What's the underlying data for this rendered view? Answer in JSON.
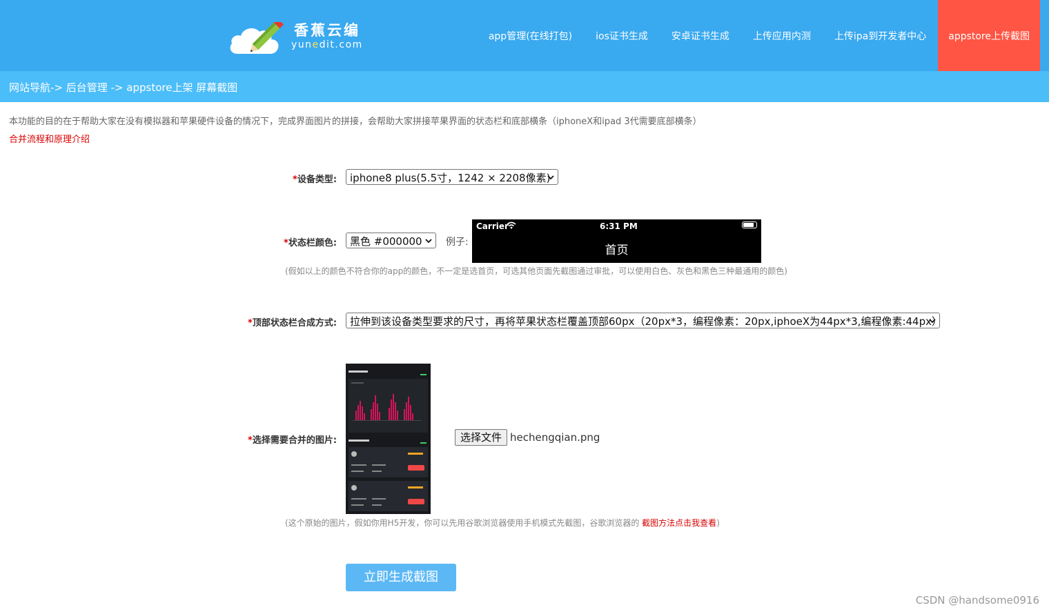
{
  "header": {
    "logo_title": "香蕉云编",
    "logo_domain_pre": "yun",
    "logo_domain_accent": "e",
    "logo_domain_post": "dit.com",
    "nav": [
      {
        "label": "app管理(在线打包)"
      },
      {
        "label": "ios证书生成"
      },
      {
        "label": "安卓证书生成"
      },
      {
        "label": "上传应用内测"
      },
      {
        "label": "上传ipa到开发者中心"
      },
      {
        "label": "appstore上传截图",
        "active": true
      }
    ],
    "bg_color": "#39a9f0",
    "active_color": "#ff5544"
  },
  "breadcrumb": "网站导航-> 后台管理 -> appstore上架 屏幕截图",
  "intro": {
    "text": "本功能的目的在于帮助大家在没有模拟器和苹果硬件设备的情况下，完成界面图片的拼接，会帮助大家拼接苹果界面的状态栏和底部横条（iphoneX和ipad 3代需要底部横条）",
    "link": "合并流程和原理介绍"
  },
  "form": {
    "required_mark": "*",
    "device": {
      "label": "设备类型:",
      "value": "iphone8 plus(5.5寸，1242 × 2208像素)"
    },
    "status_color": {
      "label": "状态栏颜色:",
      "value": "黑色 #000000",
      "example_label": "例子:",
      "hint": "(假如以上的颜色不符合你的app的颜色，不一定是选首页，可选其他页面先截图通过审批，可以使用白色、灰色和黑色三种最通用的颜色)",
      "preview": {
        "carrier": "Carrier",
        "time": "6:31 PM",
        "title": "首页",
        "bg": "#000000"
      }
    },
    "top_mode": {
      "label": "顶部状态栏合成方式:",
      "value": "拉伸到该设备类型要求的尺寸，再将苹果状态栏覆盖顶部60px（20px*3，编程像素：20px,iphoeX为44px*3,编程像素:44px）"
    },
    "image": {
      "label": "选择需要合并的图片:",
      "button": "选择文件",
      "file_name": "hechengqian.png",
      "hint_pre": "(这个原始的图片，假如你用H5开发，你可以先用谷歌浏览器使用手机模式先截图，谷歌浏览器的 ",
      "hint_link": "截图方法点击我查看",
      "hint_post": ")"
    },
    "submit": "立即生成截图"
  },
  "watermark": "CSDN @handsome0916",
  "colors": {
    "breadcrumb_bg": "#4bbdf9",
    "required": "#d80000",
    "button": "#5cb8f5"
  },
  "icons": [
    "cloud-pencil-logo-icon",
    "wifi-icon",
    "battery-icon",
    "chevron-down-icon"
  ]
}
